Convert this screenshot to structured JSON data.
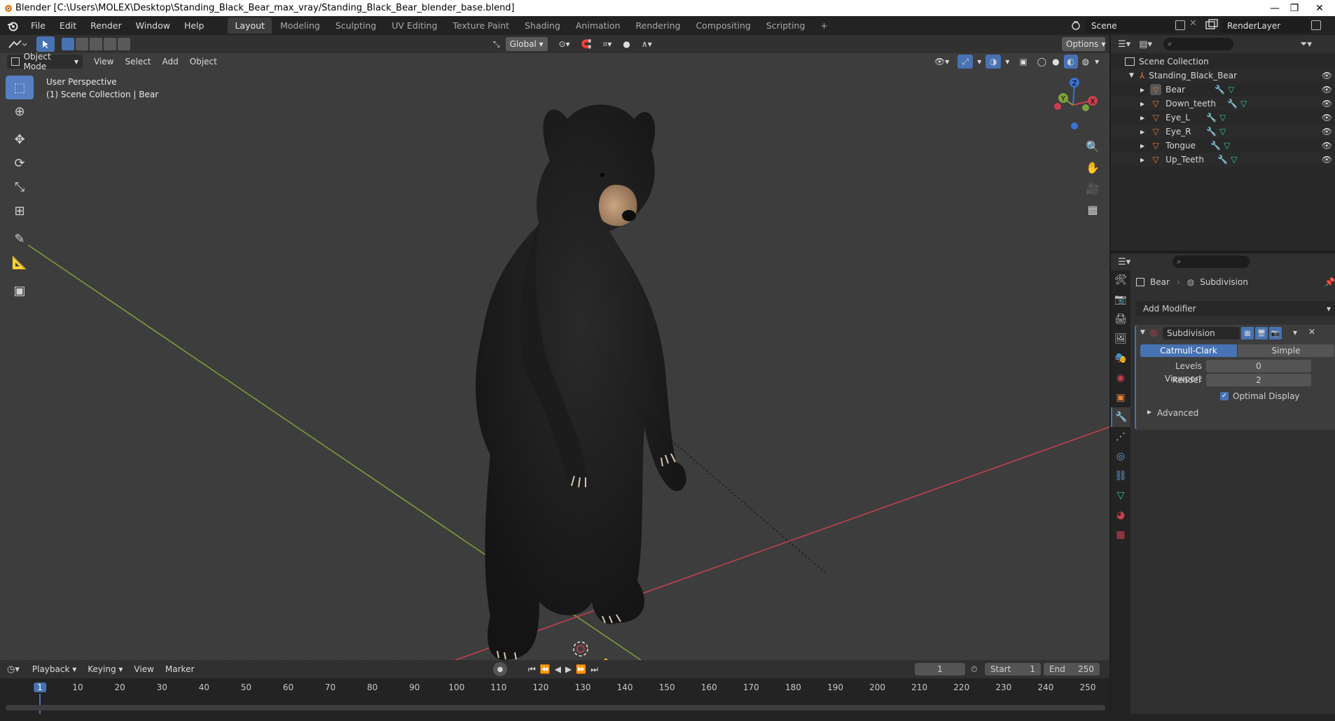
{
  "window": {
    "title": "Blender [C:\\Users\\MOLEX\\Desktop\\Standing_Black_Bear_max_vray/Standing_Black_Bear_blender_base.blend]",
    "minimize": "—",
    "restore": "❐",
    "close": "✕"
  },
  "menu": [
    "File",
    "Edit",
    "Render",
    "Window",
    "Help"
  ],
  "workspaces": [
    "Layout",
    "Modeling",
    "Sculpting",
    "UV Editing",
    "Texture Paint",
    "Shading",
    "Animation",
    "Rendering",
    "Compositing",
    "Scripting",
    "+"
  ],
  "scene": {
    "name": "Scene",
    "render_layer": "RenderLayer"
  },
  "viewport": {
    "transform_orientation": "Global",
    "options_label": "Options",
    "mode": "Object Mode",
    "menus": [
      "View",
      "Select",
      "Add",
      "Object"
    ],
    "info_line1": "User Perspective",
    "info_line2": "(1) Scene Collection | Bear",
    "gizmo": {
      "x": "X",
      "y": "Y",
      "z": "Z"
    }
  },
  "outliner": {
    "root": "Scene Collection",
    "collection": "Standing_Black_Bear",
    "objects": [
      "Bear",
      "Down_teeth",
      "Eye_L",
      "Eye_R",
      "Tongue",
      "Up_Teeth"
    ]
  },
  "properties": {
    "object_name": "Bear",
    "modifier_name": "Subdivision",
    "add_modifier": "Add Modifier",
    "modifier_field": "Subdivision",
    "mode_a": "Catmull-Clark",
    "mode_b": "Simple",
    "levels_viewport_label": "Levels Viewport",
    "levels_viewport_value": "0",
    "render_label": "Render",
    "render_value": "2",
    "optimal_display": "Optimal Display",
    "optimal_display_checked": true,
    "advanced": "Advanced"
  },
  "timeline": {
    "menus": [
      "Playback",
      "Keying",
      "View",
      "Marker"
    ],
    "current_frame": "1",
    "start_label": "Start",
    "start_value": "1",
    "end_label": "End",
    "end_value": "250",
    "ticks": [
      "1",
      "10",
      "20",
      "30",
      "40",
      "50",
      "60",
      "70",
      "80",
      "90",
      "100",
      "110",
      "120",
      "130",
      "140",
      "150",
      "160",
      "170",
      "180",
      "190",
      "200",
      "210",
      "220",
      "230",
      "240",
      "250"
    ]
  },
  "colors": {
    "accent": "#4772b3",
    "x_axis": "#c8404f",
    "y_axis": "#7ea23a",
    "z_axis": "#3a73d0",
    "object_orange": "#e0803a"
  }
}
